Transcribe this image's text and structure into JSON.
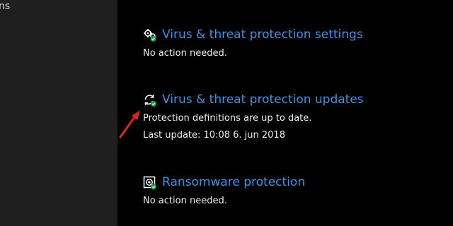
{
  "sidebar": {
    "partial_text": "ns"
  },
  "sections": [
    {
      "title": "Virus & threat protection settings",
      "lines": [
        "No action needed."
      ],
      "icon": "gears-check-icon"
    },
    {
      "title": "Virus & threat protection updates",
      "lines": [
        "Protection definitions are up to date.",
        "Last update: 10:08 6. jun 2018"
      ],
      "icon": "refresh-check-icon"
    },
    {
      "title": "Ransomware protection",
      "lines": [
        "No action needed."
      ],
      "icon": "ransomware-check-icon"
    }
  ],
  "colors": {
    "background": "#000000",
    "sidebar": "#1f1f1f",
    "link": "#3d93e6",
    "text": "#ededed",
    "ok_badge": "#1b9e3e",
    "annotation_arrow": "#e2231a"
  }
}
